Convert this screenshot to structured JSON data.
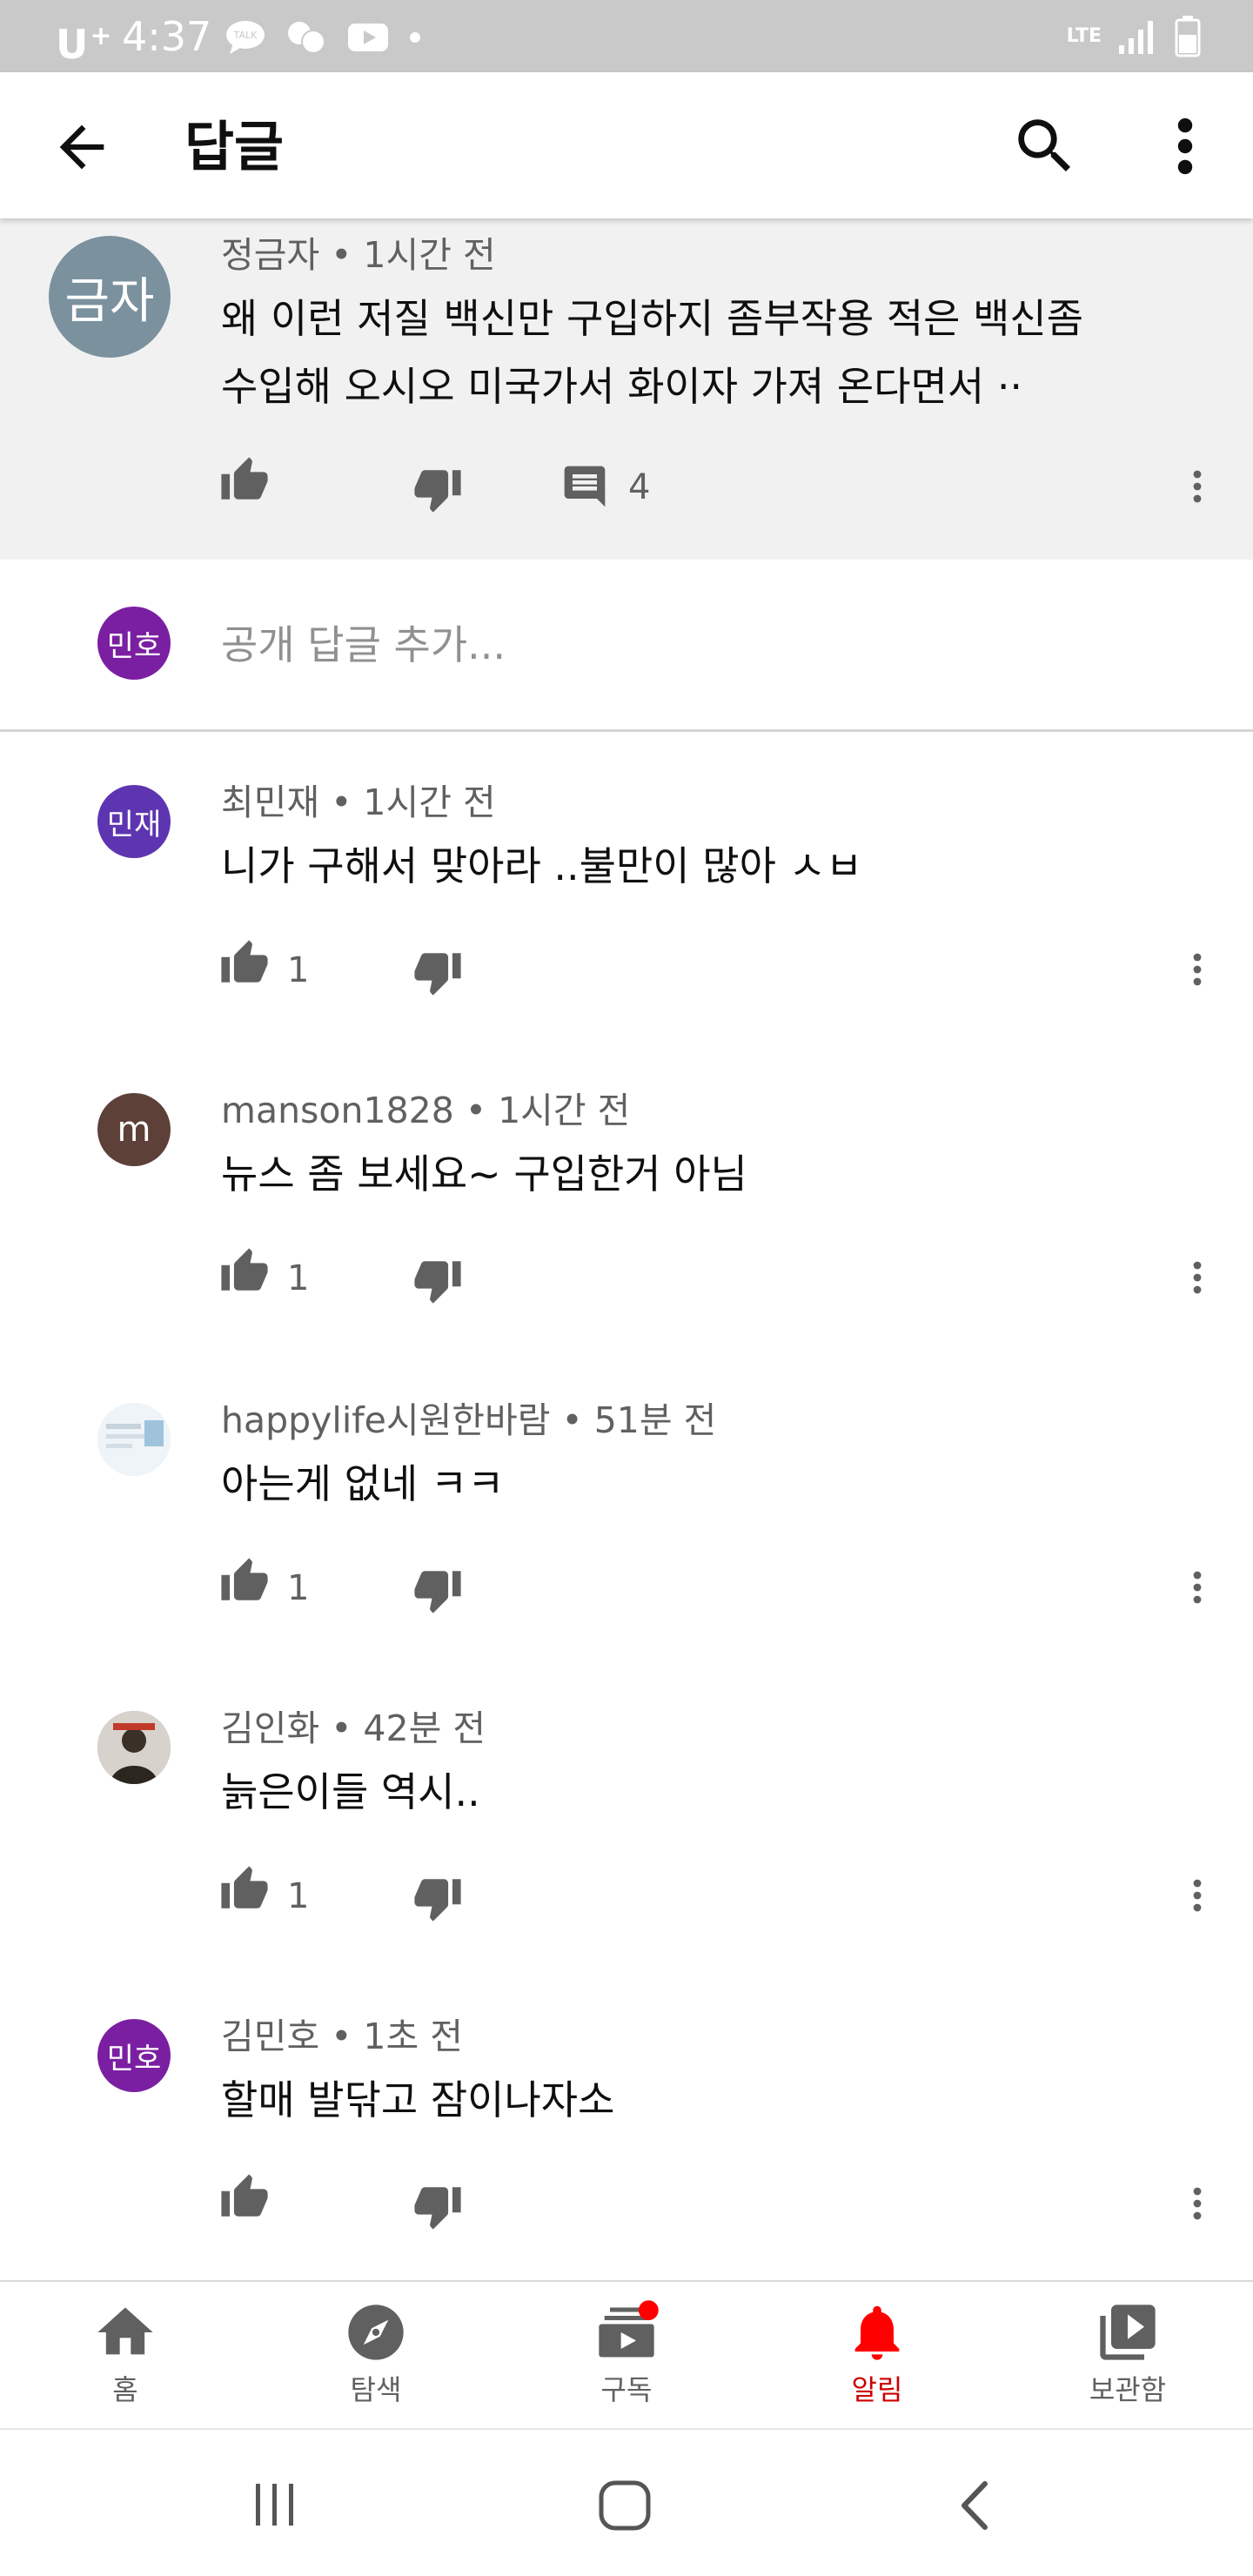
{
  "status_bar": {
    "carrier": "U",
    "carrier_plus": "+",
    "time": "4:37",
    "network": "LTE"
  },
  "header": {
    "title": "답글",
    "back_icon": "arrow-left-icon",
    "search_icon": "search-icon",
    "more_icon": "more-vert-icon"
  },
  "parent_comment": {
    "avatar_text": "금자",
    "avatar_color": "#7b919e",
    "author": "정금자",
    "time": "1시간 전",
    "lines": [
      "왜 이런 저질 백신만 구입하지 좀부작용 적은 백신좀",
      "수입해 오시오  미국가서 화이자 가져 온다면서 ··"
    ],
    "likes": "",
    "reply_count": "4"
  },
  "reply_box": {
    "avatar_text": "민호",
    "avatar_color": "#7b1fa2",
    "placeholder": "공개 답글 추가..."
  },
  "replies": [
    {
      "avatar_text": "민재",
      "avatar_type": "text",
      "avatar_color": "#5e35b1",
      "author": "최민재",
      "time": "1시간 전",
      "text": "니가 구해서 맞아라 ..불만이 많아 ㅅㅂ",
      "likes": "1"
    },
    {
      "avatar_text": "m",
      "avatar_type": "text",
      "avatar_color": "#5d4037",
      "author": "manson1828",
      "time": "1시간 전",
      "text": "뉴스 좀 보세요~ 구입한거 아님",
      "likes": "1"
    },
    {
      "avatar_text": "",
      "avatar_type": "image",
      "avatar_color": "#e3eef5",
      "author": "happylife시원한바람",
      "time": "51분 전",
      "text": "아는게 없네 ㅋㅋ",
      "likes": "1"
    },
    {
      "avatar_text": "",
      "avatar_type": "image",
      "avatar_color": "#8a8580",
      "author": "김인화",
      "time": "42분 전",
      "text": "늙은이들 역시..",
      "likes": "1"
    },
    {
      "avatar_text": "민호",
      "avatar_type": "text",
      "avatar_color": "#7b1fa2",
      "author": "김민호",
      "time": "1초 전",
      "text": "할매 발닦고 잠이나자소",
      "likes": ""
    }
  ],
  "bottom_nav": {
    "items": [
      {
        "label": "홈",
        "icon": "home-icon"
      },
      {
        "label": "탐색",
        "icon": "explore-icon"
      },
      {
        "label": "구독",
        "icon": "subscriptions-icon"
      },
      {
        "label": "알림",
        "icon": "bell-icon"
      },
      {
        "label": "보관함",
        "icon": "library-icon"
      }
    ],
    "active_index": 3,
    "active_color": "#cc0000"
  }
}
